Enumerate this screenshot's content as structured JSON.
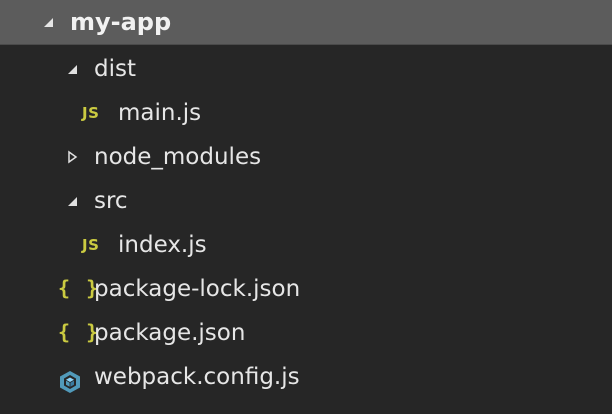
{
  "explorer": {
    "root": {
      "label": "my-app",
      "expanded": true
    },
    "items": [
      {
        "label": "dist",
        "type": "folder",
        "expanded": true,
        "depth": 1
      },
      {
        "label": "main.js",
        "type": "js-file",
        "icon_text": "JS",
        "depth": 2
      },
      {
        "label": "node_modules",
        "type": "folder",
        "expanded": false,
        "depth": 1
      },
      {
        "label": "src",
        "type": "folder",
        "expanded": true,
        "depth": 1
      },
      {
        "label": "index.js",
        "type": "js-file",
        "icon_text": "JS",
        "depth": 2
      },
      {
        "label": "package-lock.json",
        "type": "json-file",
        "icon_text": "{ }",
        "depth": 1
      },
      {
        "label": "package.json",
        "type": "json-file",
        "icon_text": "{ }",
        "depth": 1
      },
      {
        "label": "webpack.config.js",
        "type": "webpack-file",
        "icon": "webpack-icon",
        "depth": 1
      }
    ]
  },
  "colors": {
    "background": "#262626",
    "root_highlight": "#5c5c5c",
    "text": "#e6e6e6",
    "js_icon": "#cbcb41",
    "json_icon": "#cbcb41",
    "webpack_icon": "#519aba",
    "twisty": "#e0e0e0"
  }
}
